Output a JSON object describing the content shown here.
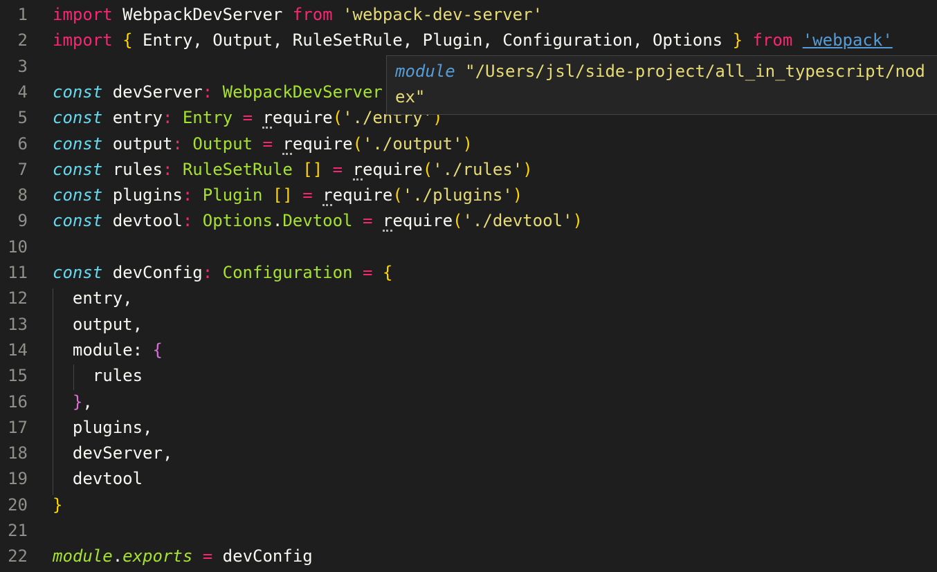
{
  "editor": {
    "language": "typescript",
    "theme_colors": {
      "background": "#1e1e1e",
      "keyword": "#f92672",
      "storage": "#66d9ef",
      "type": "#a6e22e",
      "string": "#e6db74",
      "brace_outer": "#ffd700",
      "brace_inner": "#da70d6",
      "link": "#569cd6",
      "line_number": "#8f908a"
    },
    "lines": [
      {
        "num": "1",
        "tokens": [
          [
            "keyword",
            "import"
          ],
          [
            "plain",
            " WebpackDevServer "
          ],
          [
            "keyword",
            "from"
          ],
          [
            "plain",
            " "
          ],
          [
            "string",
            "'webpack-dev-server'"
          ]
        ]
      },
      {
        "num": "2",
        "tokens": [
          [
            "keyword",
            "import"
          ],
          [
            "plain",
            " "
          ],
          [
            "brace-y",
            "{"
          ],
          [
            "plain",
            " Entry, Output, RuleSetRule, Plugin, Configuration, Options "
          ],
          [
            "brace-y",
            "}"
          ],
          [
            "plain",
            " "
          ],
          [
            "keyword",
            "from"
          ],
          [
            "plain",
            " "
          ],
          [
            "link",
            "'webpack'"
          ]
        ]
      },
      {
        "num": "3",
        "tokens": []
      },
      {
        "num": "4",
        "tokens": [
          [
            "storage",
            "const"
          ],
          [
            "plain",
            " devServer"
          ],
          [
            "operator",
            ":"
          ],
          [
            "plain",
            " "
          ],
          [
            "type",
            "WebpackDevServer"
          ]
        ]
      },
      {
        "num": "5",
        "tokens": [
          [
            "storage",
            "const"
          ],
          [
            "plain",
            " entry"
          ],
          [
            "operator",
            ":"
          ],
          [
            "plain",
            " "
          ],
          [
            "type",
            "Entry"
          ],
          [
            "plain",
            " "
          ],
          [
            "operator",
            "="
          ],
          [
            "plain",
            " "
          ],
          [
            "require",
            "require"
          ],
          [
            "brace-y",
            "("
          ],
          [
            "string",
            "'./entry'"
          ],
          [
            "brace-y",
            ")"
          ]
        ]
      },
      {
        "num": "6",
        "tokens": [
          [
            "storage",
            "const"
          ],
          [
            "plain",
            " output"
          ],
          [
            "operator",
            ":"
          ],
          [
            "plain",
            " "
          ],
          [
            "type",
            "Output"
          ],
          [
            "plain",
            " "
          ],
          [
            "operator",
            "="
          ],
          [
            "plain",
            " "
          ],
          [
            "require",
            "require"
          ],
          [
            "brace-y",
            "("
          ],
          [
            "string",
            "'./output'"
          ],
          [
            "brace-y",
            ")"
          ]
        ]
      },
      {
        "num": "7",
        "tokens": [
          [
            "storage",
            "const"
          ],
          [
            "plain",
            " rules"
          ],
          [
            "operator",
            ":"
          ],
          [
            "plain",
            " "
          ],
          [
            "type",
            "RuleSetRule"
          ],
          [
            "plain",
            " "
          ],
          [
            "brace-y",
            "[]"
          ],
          [
            "plain",
            " "
          ],
          [
            "operator",
            "="
          ],
          [
            "plain",
            " "
          ],
          [
            "require",
            "require"
          ],
          [
            "brace-y",
            "("
          ],
          [
            "string",
            "'./rules'"
          ],
          [
            "brace-y",
            ")"
          ]
        ]
      },
      {
        "num": "8",
        "tokens": [
          [
            "storage",
            "const"
          ],
          [
            "plain",
            " plugins"
          ],
          [
            "operator",
            ":"
          ],
          [
            "plain",
            " "
          ],
          [
            "type",
            "Plugin"
          ],
          [
            "plain",
            " "
          ],
          [
            "brace-y",
            "[]"
          ],
          [
            "plain",
            " "
          ],
          [
            "operator",
            "="
          ],
          [
            "plain",
            " "
          ],
          [
            "require",
            "require"
          ],
          [
            "brace-y",
            "("
          ],
          [
            "string",
            "'./plugins'"
          ],
          [
            "brace-y",
            ")"
          ]
        ]
      },
      {
        "num": "9",
        "tokens": [
          [
            "storage",
            "const"
          ],
          [
            "plain",
            " devtool"
          ],
          [
            "operator",
            ":"
          ],
          [
            "plain",
            " "
          ],
          [
            "type",
            "Options"
          ],
          [
            "plain",
            "."
          ],
          [
            "type",
            "Devtool"
          ],
          [
            "plain",
            " "
          ],
          [
            "operator",
            "="
          ],
          [
            "plain",
            " "
          ],
          [
            "require",
            "require"
          ],
          [
            "brace-y",
            "("
          ],
          [
            "string",
            "'./devtool'"
          ],
          [
            "brace-y",
            ")"
          ]
        ]
      },
      {
        "num": "10",
        "tokens": []
      },
      {
        "num": "11",
        "tokens": [
          [
            "storage",
            "const"
          ],
          [
            "plain",
            " devConfig"
          ],
          [
            "operator",
            ":"
          ],
          [
            "plain",
            " "
          ],
          [
            "type",
            "Configuration"
          ],
          [
            "plain",
            " "
          ],
          [
            "operator",
            "="
          ],
          [
            "plain",
            " "
          ],
          [
            "brace-y",
            "{"
          ]
        ]
      },
      {
        "num": "12",
        "tokens": [
          [
            "plain",
            "  entry,"
          ]
        ]
      },
      {
        "num": "13",
        "tokens": [
          [
            "plain",
            "  output,"
          ]
        ]
      },
      {
        "num": "14",
        "tokens": [
          [
            "plain",
            "  module: "
          ],
          [
            "brace-p",
            "{"
          ]
        ]
      },
      {
        "num": "15",
        "tokens": [
          [
            "plain",
            "    rules"
          ]
        ]
      },
      {
        "num": "16",
        "tokens": [
          [
            "plain",
            "  "
          ],
          [
            "brace-p",
            "}"
          ],
          [
            "plain",
            ","
          ]
        ]
      },
      {
        "num": "17",
        "tokens": [
          [
            "plain",
            "  plugins,"
          ]
        ]
      },
      {
        "num": "18",
        "tokens": [
          [
            "plain",
            "  devServer,"
          ]
        ]
      },
      {
        "num": "19",
        "tokens": [
          [
            "plain",
            "  devtool"
          ]
        ]
      },
      {
        "num": "20",
        "tokens": [
          [
            "brace-y",
            "}"
          ]
        ]
      },
      {
        "num": "21",
        "tokens": []
      },
      {
        "num": "22",
        "tokens": [
          [
            "ital-green",
            "module"
          ],
          [
            "plain",
            "."
          ],
          [
            "ital-green",
            "exports"
          ],
          [
            "plain",
            " "
          ],
          [
            "operator",
            "="
          ],
          [
            "plain",
            " devConfig"
          ]
        ]
      }
    ]
  },
  "hover_tooltip": {
    "keyword": "module",
    "line1_text": " \"/Users/jsl/side-project/all_in_typescript/nod",
    "line2_text": "ex\""
  }
}
